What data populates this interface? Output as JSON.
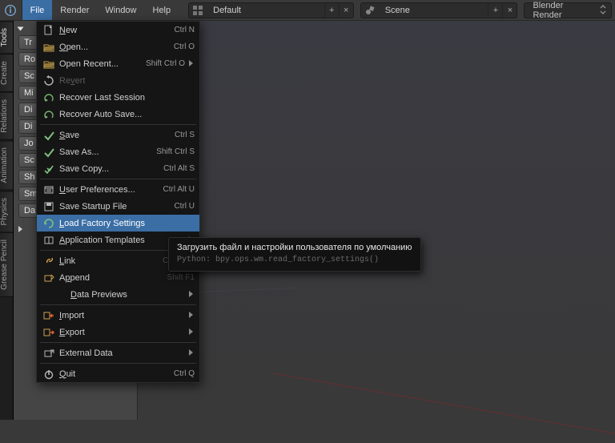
{
  "topbar": {
    "menus": [
      "File",
      "Render",
      "Window",
      "Help"
    ],
    "active_menu": 0,
    "layout": "Default",
    "scene": "Scene",
    "render_engine": "Blender Render"
  },
  "sidetabs": [
    "Tools",
    "Create",
    "Relations",
    "Animation",
    "Physics",
    "Grease Pencil"
  ],
  "toolpanel": {
    "buttons": [
      "Tr",
      "Ro",
      "Sc",
      "Mi",
      "Di",
      "Di",
      "Jo",
      "Sc",
      "Sh",
      "Sm",
      "Da"
    ]
  },
  "file_menu": {
    "items": [
      {
        "label": "New",
        "sc": "Ctrl N",
        "icon": "doc-new",
        "u": 0
      },
      {
        "label": "Open...",
        "sc": "Ctrl O",
        "icon": "folder-open",
        "u": 0
      },
      {
        "label": "Open Recent...",
        "sc": "Shift Ctrl O",
        "icon": "folder-open",
        "sub": true
      },
      {
        "label": "Revert",
        "icon": "revert",
        "disabled": true,
        "u": 2
      },
      {
        "label": "Recover Last Session",
        "icon": "recover"
      },
      {
        "label": "Recover Auto Save...",
        "icon": "recover"
      },
      {
        "sep": true
      },
      {
        "label": "Save",
        "sc": "Ctrl S",
        "icon": "save-check",
        "u": 0
      },
      {
        "label": "Save As...",
        "sc": "Shift Ctrl S",
        "icon": "save-check"
      },
      {
        "label": "Save Copy...",
        "sc": "Ctrl Alt S",
        "icon": "save-copy"
      },
      {
        "sep": true
      },
      {
        "label": "User Preferences...",
        "sc": "Ctrl Alt U",
        "icon": "prefs",
        "u": 0
      },
      {
        "label": "Save Startup File",
        "sc": "Ctrl U",
        "icon": "save-startup"
      },
      {
        "label": "Load Factory Settings",
        "icon": "factory",
        "hl": true,
        "u": 0
      },
      {
        "label": "Application Templates",
        "icon": "templates",
        "sub": true,
        "u": 0
      },
      {
        "sep": true
      },
      {
        "label": "Link",
        "sc": "Ctrl Alt O",
        "icon": "link",
        "u": 0,
        "sc_fade": true
      },
      {
        "label": "Append",
        "sc": "Shift F1",
        "icon": "append",
        "u": 1,
        "sc_fade": true
      },
      {
        "label": "Data Previews",
        "sub": true,
        "u": 0,
        "indent": true
      },
      {
        "sep": true
      },
      {
        "label": "Import",
        "icon": "import",
        "sub": true,
        "u": 0
      },
      {
        "label": "Export",
        "icon": "export",
        "sub": true,
        "u": 0
      },
      {
        "sep": true
      },
      {
        "label": "External Data",
        "icon": "external",
        "sub": true
      },
      {
        "sep": true
      },
      {
        "label": "Quit",
        "sc": "Ctrl Q",
        "icon": "quit",
        "u": 0
      }
    ]
  },
  "tooltip": {
    "title": "Загрузить файл и настройки пользователя по умолчанию",
    "python": "Python: bpy.ops.wm.read_factory_settings()"
  }
}
